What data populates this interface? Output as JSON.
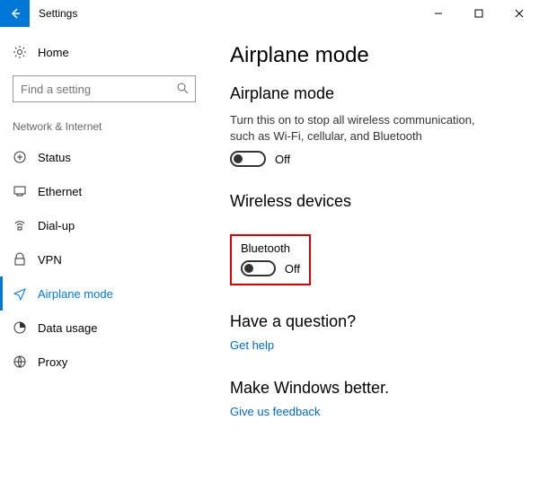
{
  "window": {
    "title": "Settings"
  },
  "sidebar": {
    "home_label": "Home",
    "search_placeholder": "Find a setting",
    "category": "Network & Internet",
    "items": [
      {
        "label": "Status"
      },
      {
        "label": "Ethernet"
      },
      {
        "label": "Dial-up"
      },
      {
        "label": "VPN"
      },
      {
        "label": "Airplane mode"
      },
      {
        "label": "Data usage"
      },
      {
        "label": "Proxy"
      }
    ]
  },
  "main": {
    "page_title": "Airplane mode",
    "airplane": {
      "heading": "Airplane mode",
      "description": "Turn this on to stop all wireless communication, such as Wi-Fi, cellular, and Bluetooth",
      "state": "Off"
    },
    "wireless": {
      "heading": "Wireless devices",
      "bluetooth_label": "Bluetooth",
      "bluetooth_state": "Off"
    },
    "question": {
      "heading": "Have a question?",
      "link": "Get help"
    },
    "feedback": {
      "heading": "Make Windows better.",
      "link": "Give us feedback"
    }
  }
}
